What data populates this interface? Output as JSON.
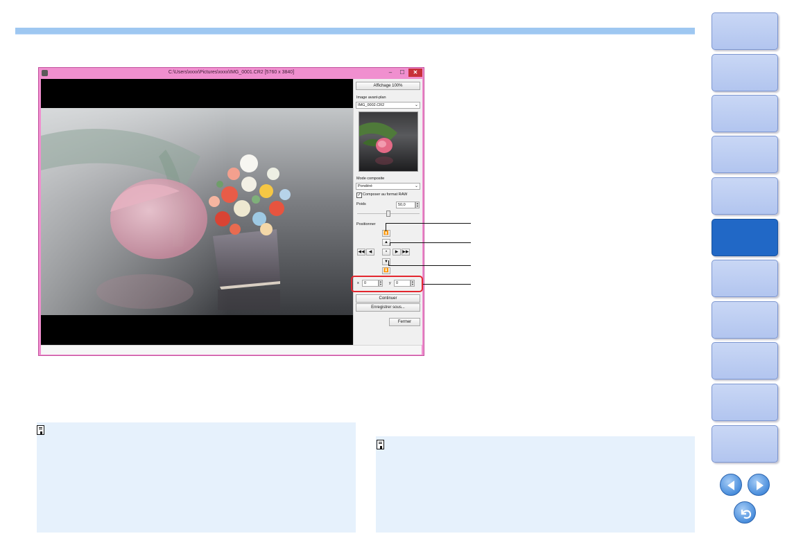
{
  "window": {
    "title": "C:\\Users\\xxxx\\Pictures\\xxxx\\IMG_0001.CR2 [5760 x 3840]",
    "controls": {
      "minimize": "–",
      "maximize": "☐",
      "close": "✕"
    }
  },
  "panel": {
    "view_100_button": "Affichage 100%",
    "foreground_label": "Image avant-plan",
    "foreground_value": "IMG_0002.CR2",
    "composite_mode_label": "Mode composite",
    "composite_mode_value": "Pondéré",
    "raw_checkbox_label": "Composer au format RAW",
    "raw_checked": true,
    "weight_label": "Poids",
    "weight_value": "50,0",
    "weight_slider_fraction": 0.5,
    "position_label": "Positionner",
    "x_label": "x",
    "x_value": "0",
    "y_label": "y",
    "y_value": "0",
    "continue_button": "Continuer",
    "save_as_button": "Enregistrer sous...",
    "close_button": "Fermer"
  },
  "sidebar": {
    "tab_count": 11,
    "active_index": 5
  },
  "icons": {
    "memo": "memo-icon",
    "prev": "prev-page-icon",
    "next": "next-page-icon",
    "back": "return-icon"
  },
  "colors": {
    "window_border": "#f08fcf",
    "highlight": "#e3262e",
    "active_tab": "#2168c6",
    "tab": "#c9d7f5",
    "note_bg": "#e6f1fc"
  }
}
